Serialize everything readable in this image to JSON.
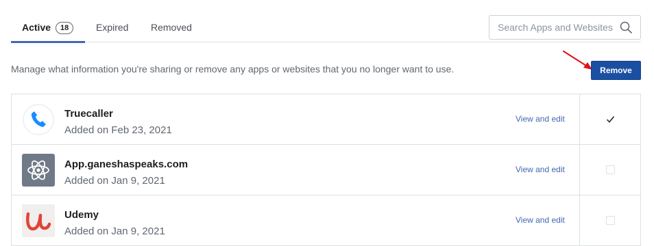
{
  "tabs": [
    {
      "label": "Active",
      "count": "18",
      "active": true
    },
    {
      "label": "Expired",
      "active": false
    },
    {
      "label": "Removed",
      "active": false
    }
  ],
  "search": {
    "placeholder": "Search Apps and Websites",
    "value": "",
    "icon": "magnifier-icon"
  },
  "description": "Manage what information you're sharing or remove any apps or websites that you no longer want to use.",
  "remove_button": {
    "label": "Remove",
    "color": "#1b4fa2"
  },
  "annotation": {
    "color": "#e0121b",
    "icon": "red-arrow-icon"
  },
  "apps": [
    {
      "name": "Truecaller",
      "date": "Added on Feb 23, 2021",
      "action": "View and edit",
      "checked": true,
      "icon": "truecaller-phone-icon"
    },
    {
      "name": "App.ganeshaspeaks.com",
      "date": "Added on Jan 9, 2021",
      "action": "View and edit",
      "checked": false,
      "icon": "atom-icon"
    },
    {
      "name": "Udemy",
      "date": "Added on Jan 9, 2021",
      "action": "View and edit",
      "checked": false,
      "icon": "udemy-logo-icon"
    }
  ],
  "colors": {
    "link": "#4267b2",
    "tab_underline": "#4267b2",
    "border": "#dddfe2"
  }
}
